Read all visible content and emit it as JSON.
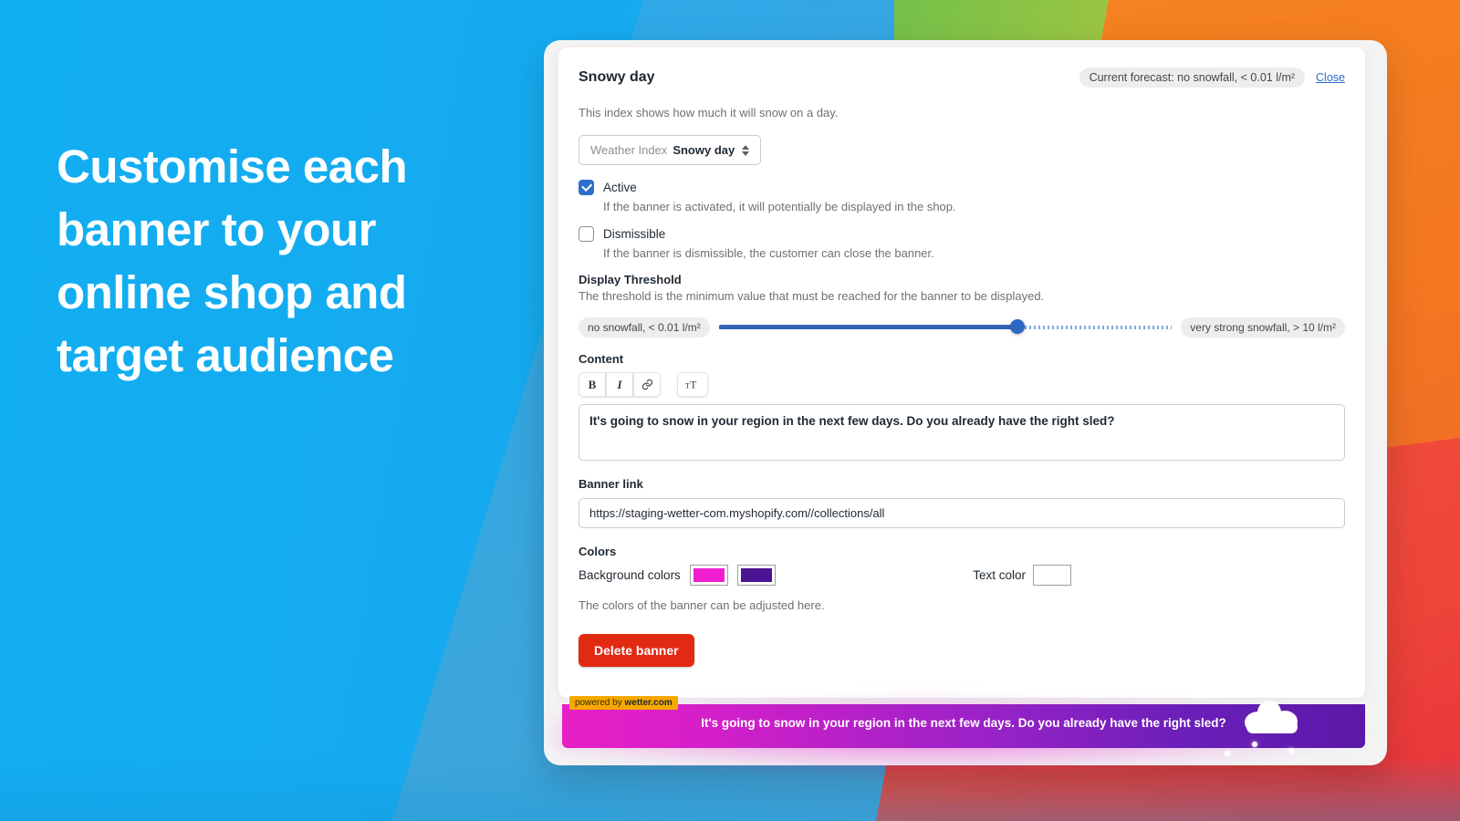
{
  "hero": {
    "headline": "Customise each banner to your online shop and target audience"
  },
  "card": {
    "title": "Snowy day",
    "forecast_pill": "Current forecast: no snowfall, < 0.01 l/m²",
    "close_label": "Close",
    "description": "This index shows how much it will snow on a day.",
    "select": {
      "label": "Weather Index",
      "value": "Snowy day"
    },
    "checkboxes": [
      {
        "label": "Active",
        "checked": true,
        "help": "If the banner is activated, it will potentially be displayed in the shop."
      },
      {
        "label": "Dismissible",
        "checked": false,
        "help": "If the banner is dismissible, the customer can close the banner."
      }
    ],
    "threshold": {
      "title": "Display Threshold",
      "subtitle": "The threshold is the minimum value that must be reached for the banner to be displayed.",
      "min_label": "no snowfall, < 0.01 l/m²",
      "max_label": "very strong snowfall, > 10 l/m²",
      "value_percent": 66
    },
    "content": {
      "title": "Content",
      "toolbar": [
        {
          "name": "bold-button",
          "glyph": "B"
        },
        {
          "name": "italic-button",
          "glyph": "I"
        },
        {
          "name": "link-button",
          "glyph": "🔗"
        },
        {
          "name": "text-size-button",
          "glyph": "T"
        }
      ],
      "text": "It's going to snow in your region in the next few days.  Do you already have the right sled?"
    },
    "banner_link": {
      "title": "Banner link",
      "value": "https://staging-wetter-com.myshopify.com//collections/all"
    },
    "colors": {
      "title": "Colors",
      "background_label": "Background colors",
      "background_1": "#F01ED0",
      "background_2": "#4A1394",
      "text_color_label": "Text color",
      "text_color": "#FFFFFF",
      "help": "The colors of the banner can be adjusted here."
    },
    "delete_label": "Delete banner"
  },
  "preview": {
    "powered_prefix": "powered by ",
    "powered_brand": "wetter.com",
    "text": "It's going to snow in your region in the next few days.  Do you already have the right sled?"
  }
}
